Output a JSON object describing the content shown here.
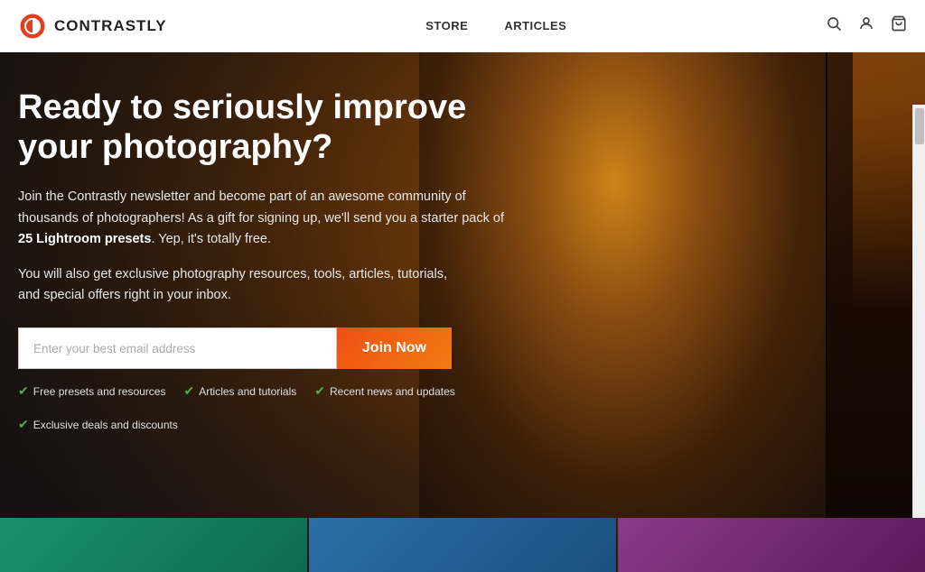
{
  "brand": {
    "name": "CONTRASTLY",
    "logo_icon": "circle-logo"
  },
  "nav": {
    "links": [
      {
        "label": "STORE",
        "id": "store"
      },
      {
        "label": "ARTICLES",
        "id": "articles"
      }
    ]
  },
  "header_icons": {
    "search": "🔍",
    "user": "👤",
    "cart": "🛒"
  },
  "hero": {
    "headline": "Ready to seriously improve your photography?",
    "body1_prefix": "Join the Contrastly newsletter and become part of an awesome community of thousands of photographers! As a gift for signing up, we'll send you a starter pack of ",
    "body1_bold": "25 Lightroom presets",
    "body1_suffix": ". Yep, it's totally free.",
    "body2": "You will also get exclusive photography resources, tools, articles, tutorials, and special offers right in your inbox.",
    "email_placeholder": "Enter your best email address",
    "join_button": "Join Now",
    "benefits": [
      {
        "label": "Free presets and resources"
      },
      {
        "label": "Articles and tutorials"
      },
      {
        "label": "Recent news and updates"
      },
      {
        "label": "Exclusive deals and discounts"
      }
    ]
  }
}
